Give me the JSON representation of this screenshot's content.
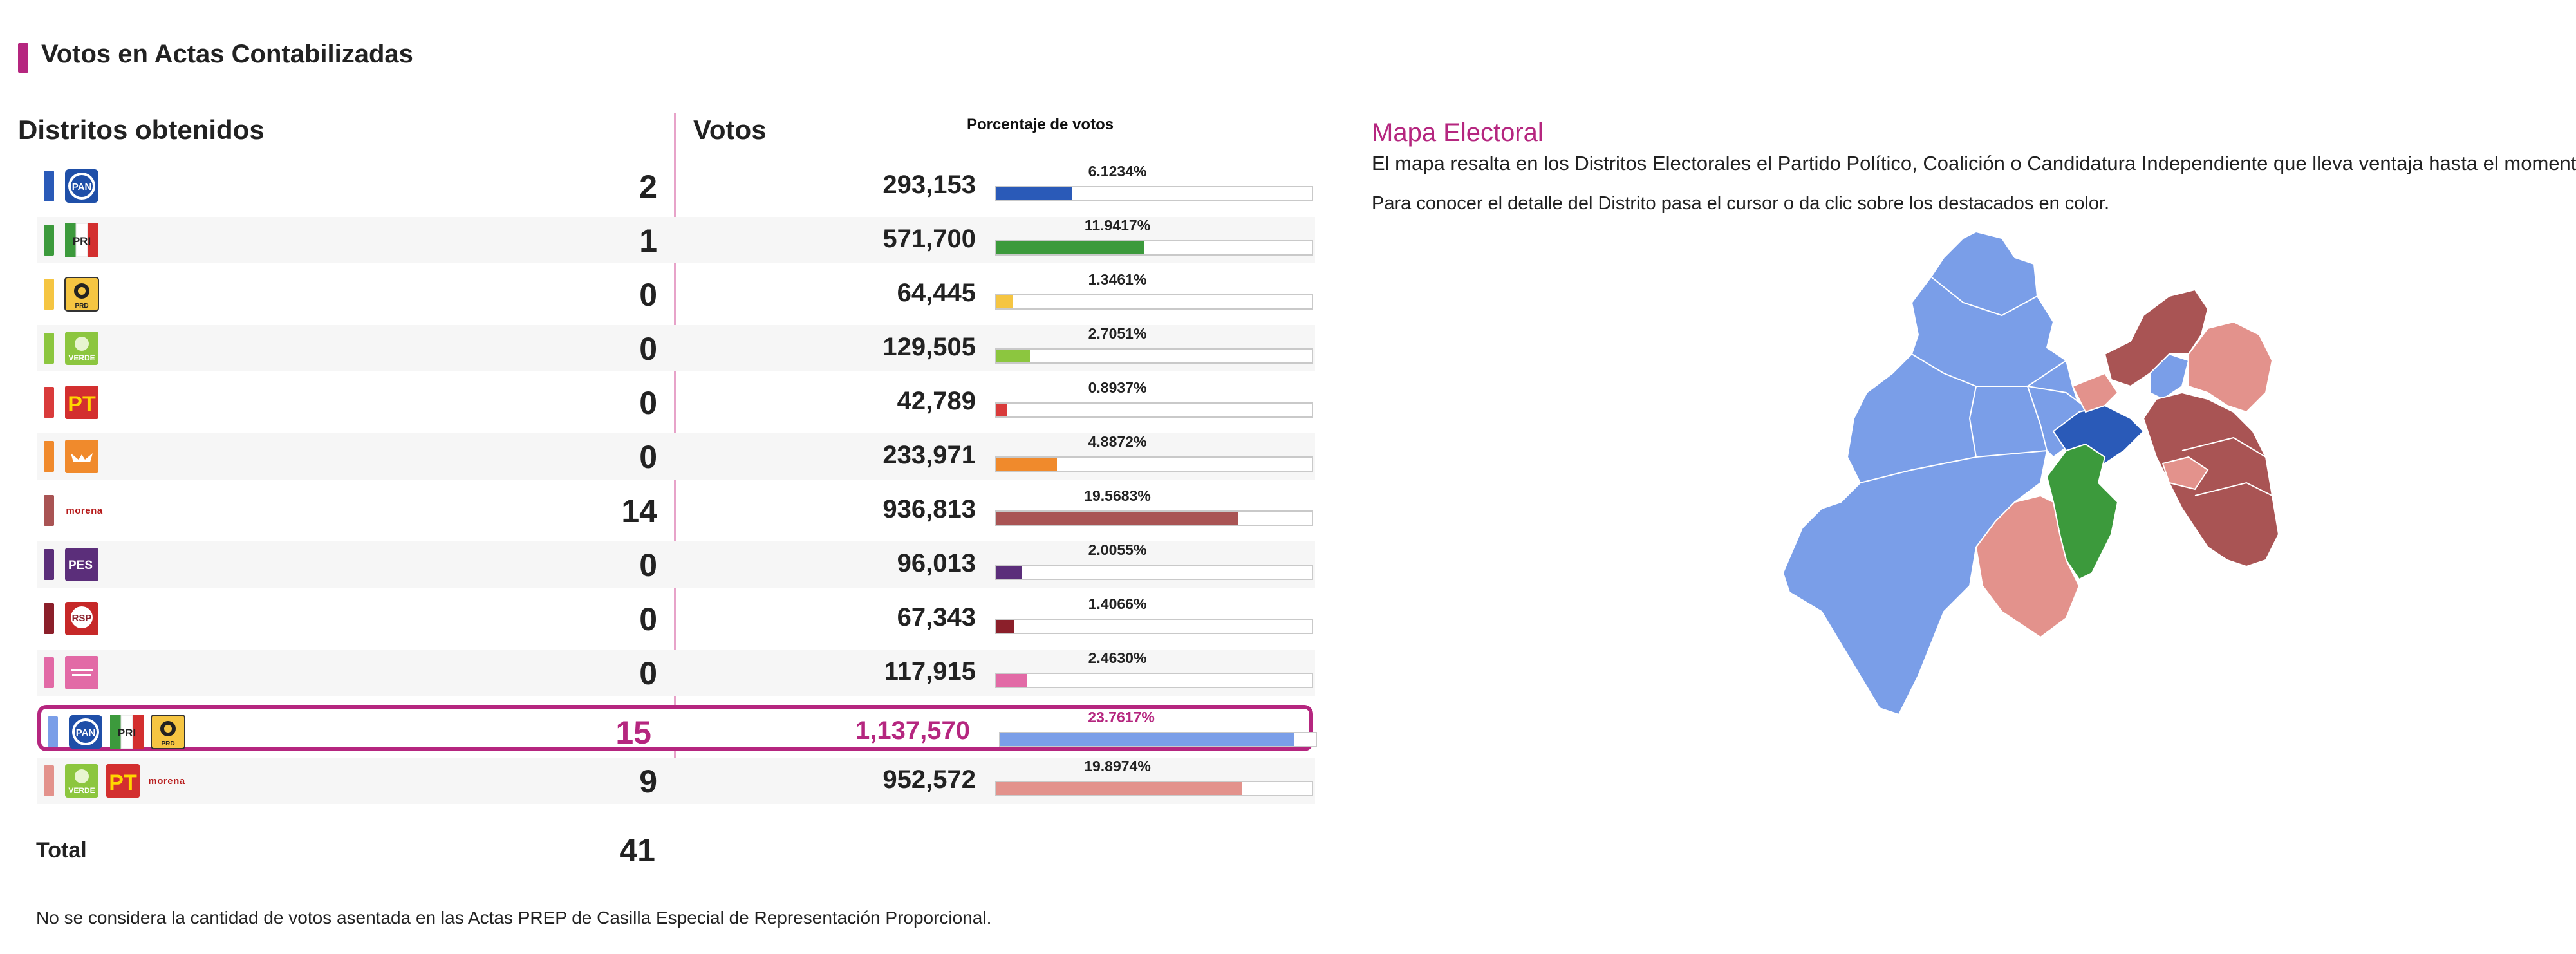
{
  "header": {
    "title": "Votos en Actas Contabilizadas"
  },
  "columns": {
    "distritos": "Distritos obtenidos",
    "votos": "Votos",
    "porcentaje": "Porcentaje de votos"
  },
  "colors": {
    "accent": "#b5267f",
    "pan": "#2a5ab8",
    "pri": "#3c9a3c",
    "prd": "#f5c542",
    "verde": "#8cc63f",
    "pt": "#d93b3b",
    "mc": "#f08a2c",
    "morena": "#a95454",
    "pes": "#5b2e7a",
    "rsp": "#8b1f2a",
    "fm": "#e26aa6",
    "coalition_pan_pri_prd": "#7a9ee8",
    "coalition_verde_pt_morena": "#e3928c"
  },
  "rows": [
    {
      "logos": [
        "PAN"
      ],
      "districts": "2",
      "votes": "293,153",
      "percent_label": "6.1234%",
      "percent": 6.1234,
      "color": "#2a5ab8"
    },
    {
      "logos": [
        "PRI"
      ],
      "districts": "1",
      "votes": "571,700",
      "percent_label": "11.9417%",
      "percent": 11.9417,
      "color": "#3c9a3c"
    },
    {
      "logos": [
        "PRD"
      ],
      "districts": "0",
      "votes": "64,445",
      "percent_label": "1.3461%",
      "percent": 1.3461,
      "color": "#f5c542"
    },
    {
      "logos": [
        "VERDE"
      ],
      "districts": "0",
      "votes": "129,505",
      "percent_label": "2.7051%",
      "percent": 2.7051,
      "color": "#8cc63f"
    },
    {
      "logos": [
        "PT"
      ],
      "districts": "0",
      "votes": "42,789",
      "percent_label": "0.8937%",
      "percent": 0.8937,
      "color": "#d93b3b"
    },
    {
      "logos": [
        "MC"
      ],
      "districts": "0",
      "votes": "233,971",
      "percent_label": "4.8872%",
      "percent": 4.8872,
      "color": "#f08a2c"
    },
    {
      "logos": [
        "morena"
      ],
      "districts": "14",
      "votes": "936,813",
      "percent_label": "19.5683%",
      "percent": 19.5683,
      "color": "#a95454"
    },
    {
      "logos": [
        "PES"
      ],
      "districts": "0",
      "votes": "96,013",
      "percent_label": "2.0055%",
      "percent": 2.0055,
      "color": "#5b2e7a"
    },
    {
      "logos": [
        "RSP"
      ],
      "districts": "0",
      "votes": "67,343",
      "percent_label": "1.4066%",
      "percent": 1.4066,
      "color": "#8b1f2a"
    },
    {
      "logos": [
        "FXM"
      ],
      "districts": "0",
      "votes": "117,915",
      "percent_label": "2.4630%",
      "percent": 2.463,
      "color": "#e26aa6"
    },
    {
      "logos": [
        "PAN",
        "PRI",
        "PRD"
      ],
      "districts": "15",
      "votes": "1,137,570",
      "percent_label": "23.7617%",
      "percent": 23.7617,
      "color": "#7a9ee8",
      "highlighted": true
    },
    {
      "logos": [
        "VERDE",
        "PT",
        "morena"
      ],
      "districts": "9",
      "votes": "952,572",
      "percent_label": "19.8974%",
      "percent": 19.8974,
      "color": "#e3928c"
    }
  ],
  "total": {
    "label": "Total",
    "value": "41"
  },
  "footnote": "No se considera la cantidad de votos asentada en las Actas PREP de Casilla Especial de Representación Proporcional.",
  "map": {
    "title": "Mapa Electoral",
    "description": "El mapa resalta en los Distritos Electorales el Partido Político, Coalición o Candidatura Independiente que lleva ventaja hasta el momento.",
    "hint": "Para conocer el detalle del Distrito pasa el cursor o da clic sobre los destacados en color."
  },
  "logo_text": {
    "PAN": "PAN",
    "PRI": "PRI",
    "PRD": "PRD",
    "VERDE": "VERDE",
    "PT": "PT",
    "morena": "morena",
    "PES": "PES",
    "RSP": "RSP"
  }
}
